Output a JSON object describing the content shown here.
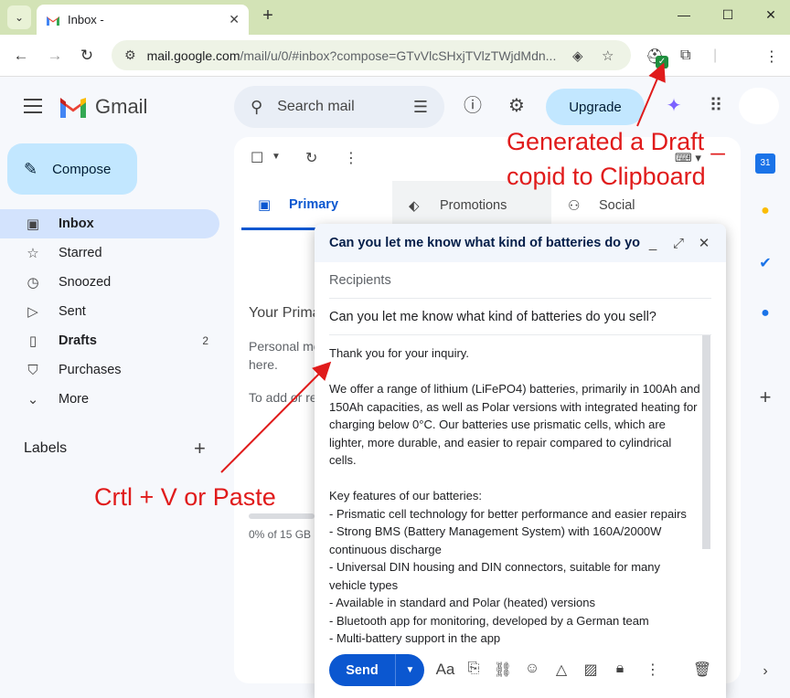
{
  "browser": {
    "tab_title": "Inbox -",
    "tab_close": "✕",
    "new_tab": "+",
    "url_host": "mail.google.com",
    "url_rest": "/mail/u/0/#inbox?compose=GTvVlcSHxjTVlzTWjdMdn...",
    "window": {
      "minimize": "—",
      "maximize": "☐",
      "close": "✕"
    }
  },
  "gmail": {
    "logo_word": "Gmail",
    "search_placeholder": "Search mail",
    "upgrade": "Upgrade",
    "compose": "Compose"
  },
  "nav": [
    {
      "icon": "inbox-icon",
      "glyph": "▣",
      "label": "Inbox",
      "count": ""
    },
    {
      "icon": "star-icon",
      "glyph": "☆",
      "label": "Starred",
      "count": ""
    },
    {
      "icon": "clock-icon",
      "glyph": "◷",
      "label": "Snoozed",
      "count": ""
    },
    {
      "icon": "send-icon",
      "glyph": "▷",
      "label": "Sent",
      "count": ""
    },
    {
      "icon": "draft-icon",
      "glyph": "▯",
      "label": "Drafts",
      "count": "2"
    },
    {
      "icon": "purchases-icon",
      "glyph": "⛉",
      "label": "Purchases",
      "count": ""
    },
    {
      "icon": "chevron-down-icon",
      "glyph": "⌄",
      "label": "More",
      "count": ""
    }
  ],
  "labels": {
    "title": "Labels",
    "add": "+"
  },
  "tabs": [
    {
      "label": "Primary",
      "glyph": "▣"
    },
    {
      "label": "Promotions",
      "glyph": "⬖"
    },
    {
      "label": "Social",
      "glyph": "⚇"
    }
  ],
  "main_empty": {
    "line1": "Your Prima",
    "line2a": "Personal me",
    "line2b": "here.",
    "line3": "To add or re",
    "storage": "0% of 15 GB u"
  },
  "compose_window": {
    "header_title": "Can you let me know what kind of batteries do yo...",
    "recipients_placeholder": "Recipients",
    "subject": "Can you let me know what kind of batteries do you sell?",
    "body": "Thank you for your inquiry.\n\nWe offer a range of lithium (LiFePO4) batteries, primarily in 100Ah and 150Ah capacities, as well as Polar versions with integrated heating for charging below 0°C. Our batteries use prismatic cells, which are lighter, more durable, and easier to repair compared to cylindrical cells.\n\nKey features of our batteries:\n- Prismatic cell technology for better performance and easier repairs\n- Strong BMS (Battery Management System) with 160A/2000W continuous discharge\n- Universal DIN housing and DIN connectors, suitable for many vehicle types\n- Available in standard and Polar (heated) versions\n- Bluetooth app for monitoring, developed by a German team\n- Multi-battery support in the app",
    "send": "Send",
    "format": "Aa"
  },
  "annotations": {
    "top_line1": "Generated a Draft _",
    "top_line2": "copid to Clipboard",
    "bottom": "Crtl + V or Paste",
    "color": "#e01b1b"
  },
  "side_panel": {
    "calendar_day": "31",
    "add": "+"
  }
}
